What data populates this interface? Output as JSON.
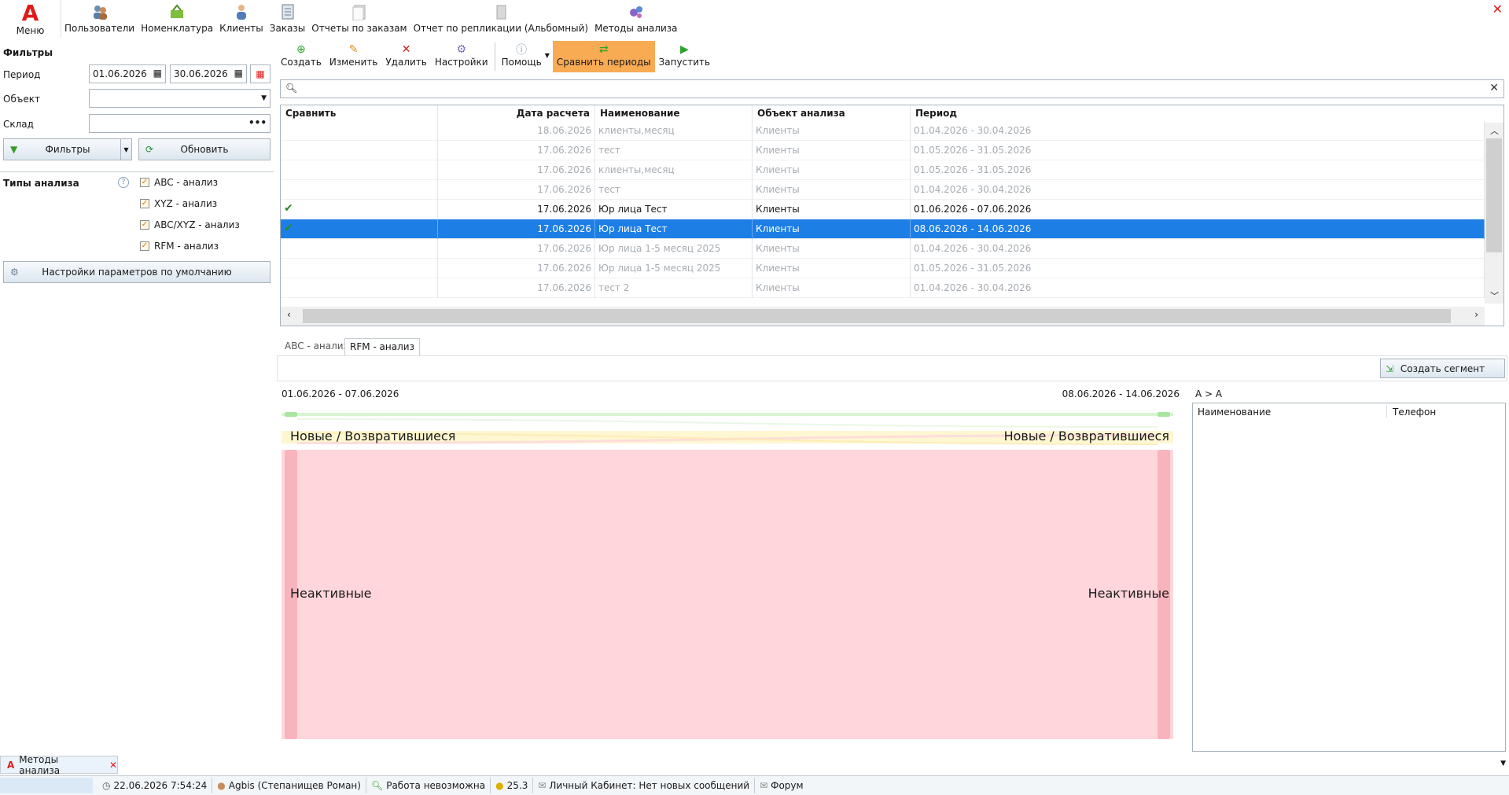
{
  "top": {
    "menu_label": "Меню",
    "items": [
      {
        "label": "Пользователи",
        "icon": "users-icon"
      },
      {
        "label": "Номенклатура",
        "icon": "nomenclature-icon"
      },
      {
        "label": "Клиенты",
        "icon": "client-icon"
      },
      {
        "label": "Заказы",
        "icon": "orders-icon"
      },
      {
        "label": "Отчеты по заказам",
        "icon": "order-reports-icon"
      },
      {
        "label": "Отчет по репликации (Альбомный)",
        "icon": "replication-report-icon"
      },
      {
        "label": "Методы анализа",
        "icon": "analysis-methods-icon"
      }
    ]
  },
  "filters": {
    "title": "Фильтры",
    "period_label": "Период",
    "date_from": "01.06.2026",
    "date_to": "30.06.2026",
    "object_label": "Объект",
    "object_value": "",
    "warehouse_label": "Склад",
    "warehouse_value": "",
    "filters_button": "Фильтры",
    "refresh_button": "Обновить"
  },
  "analysis_types": {
    "title": "Типы анализа",
    "items": [
      "ABC - анализ",
      "XYZ - анализ",
      "ABC/XYZ - анализ",
      "RFM - анализ"
    ]
  },
  "defaults_button": "Настройки параметров по умолчанию",
  "toolbar": {
    "create": "Создать",
    "edit": "Изменить",
    "delete": "Удалить",
    "settings": "Настройки",
    "help": "Помощь",
    "compare": "Сравнить периоды",
    "run": "Запустить"
  },
  "search": {
    "placeholder": ""
  },
  "grid": {
    "headers": [
      "Сравнить",
      "Дата расчета",
      "Наименование",
      "Объект анализа",
      "Период"
    ],
    "rows": [
      {
        "check": "",
        "date": "18.06.2026",
        "name": "клиенты,месяц",
        "object": "Клиенты",
        "period": "01.04.2026 - 30.04.2026",
        "state": "dim"
      },
      {
        "check": "",
        "date": "17.06.2026",
        "name": "тест",
        "object": "Клиенты",
        "period": "01.05.2026 - 31.05.2026",
        "state": "dim"
      },
      {
        "check": "",
        "date": "17.06.2026",
        "name": "клиенты,месяц",
        "object": "Клиенты",
        "period": "01.05.2026 - 31.05.2026",
        "state": "dim"
      },
      {
        "check": "",
        "date": "17.06.2026",
        "name": "тест",
        "object": "Клиенты",
        "period": "01.04.2026 - 30.04.2026",
        "state": "dim"
      },
      {
        "check": "✔",
        "date": "17.06.2026",
        "name": "Юр лица Тест",
        "object": "Клиенты",
        "period": "01.06.2026 - 07.06.2026",
        "state": "normal"
      },
      {
        "check": "✔",
        "date": "17.06.2026",
        "name": "Юр лица Тест",
        "object": "Клиенты",
        "period": "08.06.2026 - 14.06.2026",
        "state": "selected"
      },
      {
        "check": "",
        "date": "17.06.2026",
        "name": "Юр лица 1-5 месяц 2025",
        "object": "Клиенты",
        "period": "01.04.2026 - 30.04.2026",
        "state": "dim"
      },
      {
        "check": "",
        "date": "17.06.2026",
        "name": "Юр лица 1-5 месяц 2025",
        "object": "Клиенты",
        "period": "01.05.2026 - 31.05.2026",
        "state": "dim"
      },
      {
        "check": "",
        "date": "17.06.2026",
        "name": "тест 2",
        "object": "Клиенты",
        "period": "01.04.2026 - 30.04.2026",
        "state": "dim"
      }
    ]
  },
  "tabs": {
    "abc": "ABC - анализ",
    "rfm": "RFM - анализ"
  },
  "segment_button": "Создать сегмент",
  "sankey": {
    "left_period": "01.06.2026 - 07.06.2026",
    "right_period": "08.06.2026 - 14.06.2026",
    "label_new": "Новые / Возвратившиеся",
    "label_inactive": "Неактивные",
    "colors": {
      "green": "#a8e6a0",
      "yellow": "#fff3b0",
      "red": "#ffd6dc",
      "red_bar": "#f8b4bd"
    }
  },
  "right_panel": {
    "title": "A > A",
    "headers": [
      "Наименование",
      "Телефон"
    ]
  },
  "bottom_tab": "Методы анализа",
  "status": {
    "datetime": "22.06.2026 7:54:24",
    "user": "Agbis (Степанищев Роман)",
    "work": "Работа невозможна",
    "version": "25.3",
    "cabinet": "Личный Кабинет: Нет новых сообщений",
    "forum": "Форум"
  }
}
